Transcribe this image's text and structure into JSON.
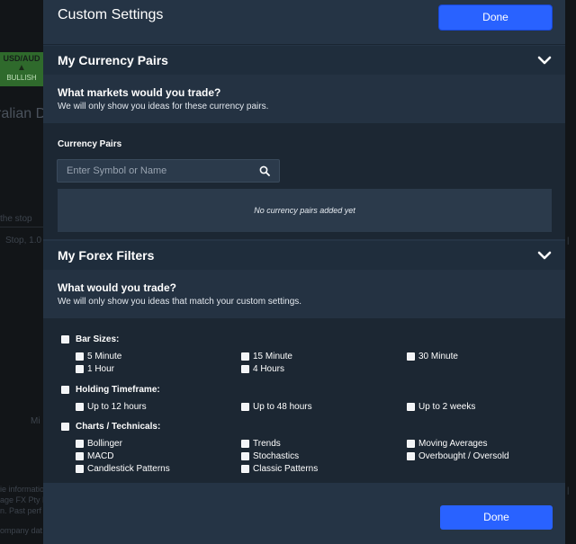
{
  "background": {
    "ticker": {
      "symbol": "USD/AUD",
      "signal": "BULLISH"
    },
    "title_fragment": "ralian D",
    "text_fragment_1": "the stop",
    "text_fragment_2": "Stop, 1.0",
    "text_fragment_3": "Mi",
    "footer_lines": [
      "ie informatio",
      "age FX Pty L",
      "n. Past perf"
    ],
    "footer_bottom": "ompany dat"
  },
  "header": {
    "title": "Custom Settings",
    "done_label": "Done"
  },
  "currency_section": {
    "title": "My Currency Pairs",
    "question": "What markets would you trade?",
    "subtitle": "We will only show you ideas for these currency pairs.",
    "field_label": "Currency Pairs",
    "search_placeholder": "Enter Symbol or Name",
    "search_value": "",
    "empty_message": "No currency pairs added yet"
  },
  "filters_section": {
    "title": "My Forex Filters",
    "question": "What would you trade?",
    "subtitle": "We will only show you ideas that match your custom settings.",
    "groups": [
      {
        "label": "Bar Sizes:",
        "options": [
          "5 Minute",
          "15 Minute",
          "30 Minute",
          "1 Hour",
          "4 Hours"
        ]
      },
      {
        "label": "Holding Timeframe:",
        "options": [
          "Up to 12 hours",
          "Up to 48 hours",
          "Up to 2 weeks"
        ]
      },
      {
        "label": "Charts / Technicals:",
        "options": [
          "Bollinger",
          "Trends",
          "Moving Averages",
          "MACD",
          "Stochastics",
          "Overbought / Oversold",
          "Candlestick Patterns",
          "Classic Patterns"
        ]
      }
    ]
  },
  "footer": {
    "done_label": "Done"
  },
  "colors": {
    "modal_bg": "#253445",
    "section_header_bg": "#1f2d3c",
    "panel_bg": "#1c2733",
    "input_bg": "#2b3a4b",
    "primary_button": "#2962ff",
    "bullish_green": "#2f6a2c"
  },
  "icons": {
    "collapse": "chevron-down-icon",
    "search": "search-icon"
  }
}
